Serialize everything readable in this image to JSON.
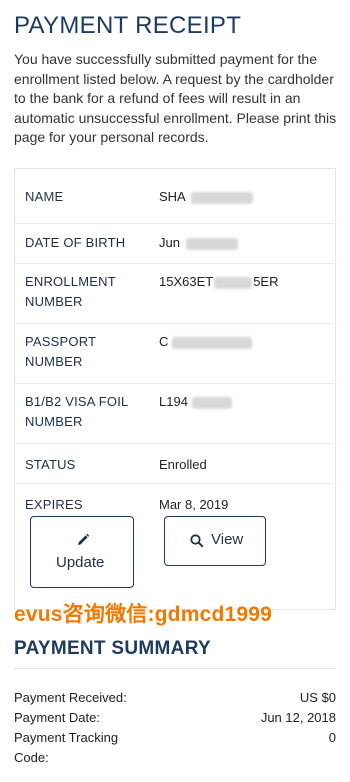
{
  "page": {
    "title": "PAYMENT RECEIPT",
    "intro": "You have successfully submitted payment for the enrollment listed below. A request by the cardholder to the bank for a refund of fees will result in an automatic unsuccessful enrollment. Please print this page for your personal records."
  },
  "details": [
    {
      "label": "NAME",
      "value": "SHA"
    },
    {
      "label": "DATE OF BIRTH",
      "value": "Jun"
    },
    {
      "label": "ENROLLMENT NUMBER",
      "value": "15X63ET",
      "value_tail": "5ER"
    },
    {
      "label": "PASSPORT NUMBER",
      "value": "C"
    },
    {
      "label": "B1/B2 VISA FOIL NUMBER",
      "value": "L194"
    },
    {
      "label": "STATUS",
      "value": "Enrolled"
    },
    {
      "label": "EXPIRES",
      "value": "Mar 8, 2019"
    }
  ],
  "actions": {
    "update_label": "Update",
    "update_icon": "pencil-icon",
    "view_label": "View",
    "view_icon": "search-icon"
  },
  "watermark": "evus咨询微信:gdmcd1999",
  "summary": {
    "title": "PAYMENT SUMMARY",
    "rows": [
      {
        "label": "Payment Received:",
        "value": "US $0"
      },
      {
        "label": "Payment Date:",
        "value": "Jun 12, 2018"
      },
      {
        "label": "Payment Tracking Code:",
        "value": "0"
      }
    ]
  },
  "colors": {
    "heading": "#1f3a5f",
    "watermark": "#f07a00",
    "border": "#ececec"
  }
}
